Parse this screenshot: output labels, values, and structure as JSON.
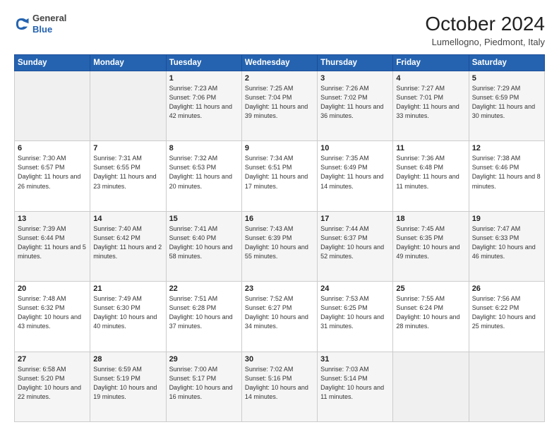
{
  "header": {
    "logo": {
      "general": "General",
      "blue": "Blue"
    },
    "title": "October 2024",
    "location": "Lumellogno, Piedmont, Italy"
  },
  "weekdays": [
    "Sunday",
    "Monday",
    "Tuesday",
    "Wednesday",
    "Thursday",
    "Friday",
    "Saturday"
  ],
  "weeks": [
    [
      null,
      null,
      {
        "day": 1,
        "sunrise": "7:23 AM",
        "sunset": "7:06 PM",
        "daylight": "11 hours and 42 minutes."
      },
      {
        "day": 2,
        "sunrise": "7:25 AM",
        "sunset": "7:04 PM",
        "daylight": "11 hours and 39 minutes."
      },
      {
        "day": 3,
        "sunrise": "7:26 AM",
        "sunset": "7:02 PM",
        "daylight": "11 hours and 36 minutes."
      },
      {
        "day": 4,
        "sunrise": "7:27 AM",
        "sunset": "7:01 PM",
        "daylight": "11 hours and 33 minutes."
      },
      {
        "day": 5,
        "sunrise": "7:29 AM",
        "sunset": "6:59 PM",
        "daylight": "11 hours and 30 minutes."
      }
    ],
    [
      {
        "day": 6,
        "sunrise": "7:30 AM",
        "sunset": "6:57 PM",
        "daylight": "11 hours and 26 minutes."
      },
      {
        "day": 7,
        "sunrise": "7:31 AM",
        "sunset": "6:55 PM",
        "daylight": "11 hours and 23 minutes."
      },
      {
        "day": 8,
        "sunrise": "7:32 AM",
        "sunset": "6:53 PM",
        "daylight": "11 hours and 20 minutes."
      },
      {
        "day": 9,
        "sunrise": "7:34 AM",
        "sunset": "6:51 PM",
        "daylight": "11 hours and 17 minutes."
      },
      {
        "day": 10,
        "sunrise": "7:35 AM",
        "sunset": "6:49 PM",
        "daylight": "11 hours and 14 minutes."
      },
      {
        "day": 11,
        "sunrise": "7:36 AM",
        "sunset": "6:48 PM",
        "daylight": "11 hours and 11 minutes."
      },
      {
        "day": 12,
        "sunrise": "7:38 AM",
        "sunset": "6:46 PM",
        "daylight": "11 hours and 8 minutes."
      }
    ],
    [
      {
        "day": 13,
        "sunrise": "7:39 AM",
        "sunset": "6:44 PM",
        "daylight": "11 hours and 5 minutes."
      },
      {
        "day": 14,
        "sunrise": "7:40 AM",
        "sunset": "6:42 PM",
        "daylight": "11 hours and 2 minutes."
      },
      {
        "day": 15,
        "sunrise": "7:41 AM",
        "sunset": "6:40 PM",
        "daylight": "10 hours and 58 minutes."
      },
      {
        "day": 16,
        "sunrise": "7:43 AM",
        "sunset": "6:39 PM",
        "daylight": "10 hours and 55 minutes."
      },
      {
        "day": 17,
        "sunrise": "7:44 AM",
        "sunset": "6:37 PM",
        "daylight": "10 hours and 52 minutes."
      },
      {
        "day": 18,
        "sunrise": "7:45 AM",
        "sunset": "6:35 PM",
        "daylight": "10 hours and 49 minutes."
      },
      {
        "day": 19,
        "sunrise": "7:47 AM",
        "sunset": "6:33 PM",
        "daylight": "10 hours and 46 minutes."
      }
    ],
    [
      {
        "day": 20,
        "sunrise": "7:48 AM",
        "sunset": "6:32 PM",
        "daylight": "10 hours and 43 minutes."
      },
      {
        "day": 21,
        "sunrise": "7:49 AM",
        "sunset": "6:30 PM",
        "daylight": "10 hours and 40 minutes."
      },
      {
        "day": 22,
        "sunrise": "7:51 AM",
        "sunset": "6:28 PM",
        "daylight": "10 hours and 37 minutes."
      },
      {
        "day": 23,
        "sunrise": "7:52 AM",
        "sunset": "6:27 PM",
        "daylight": "10 hours and 34 minutes."
      },
      {
        "day": 24,
        "sunrise": "7:53 AM",
        "sunset": "6:25 PM",
        "daylight": "10 hours and 31 minutes."
      },
      {
        "day": 25,
        "sunrise": "7:55 AM",
        "sunset": "6:24 PM",
        "daylight": "10 hours and 28 minutes."
      },
      {
        "day": 26,
        "sunrise": "7:56 AM",
        "sunset": "6:22 PM",
        "daylight": "10 hours and 25 minutes."
      }
    ],
    [
      {
        "day": 27,
        "sunrise": "6:58 AM",
        "sunset": "5:20 PM",
        "daylight": "10 hours and 22 minutes."
      },
      {
        "day": 28,
        "sunrise": "6:59 AM",
        "sunset": "5:19 PM",
        "daylight": "10 hours and 19 minutes."
      },
      {
        "day": 29,
        "sunrise": "7:00 AM",
        "sunset": "5:17 PM",
        "daylight": "10 hours and 16 minutes."
      },
      {
        "day": 30,
        "sunrise": "7:02 AM",
        "sunset": "5:16 PM",
        "daylight": "10 hours and 14 minutes."
      },
      {
        "day": 31,
        "sunrise": "7:03 AM",
        "sunset": "5:14 PM",
        "daylight": "10 hours and 11 minutes."
      },
      null,
      null
    ]
  ]
}
